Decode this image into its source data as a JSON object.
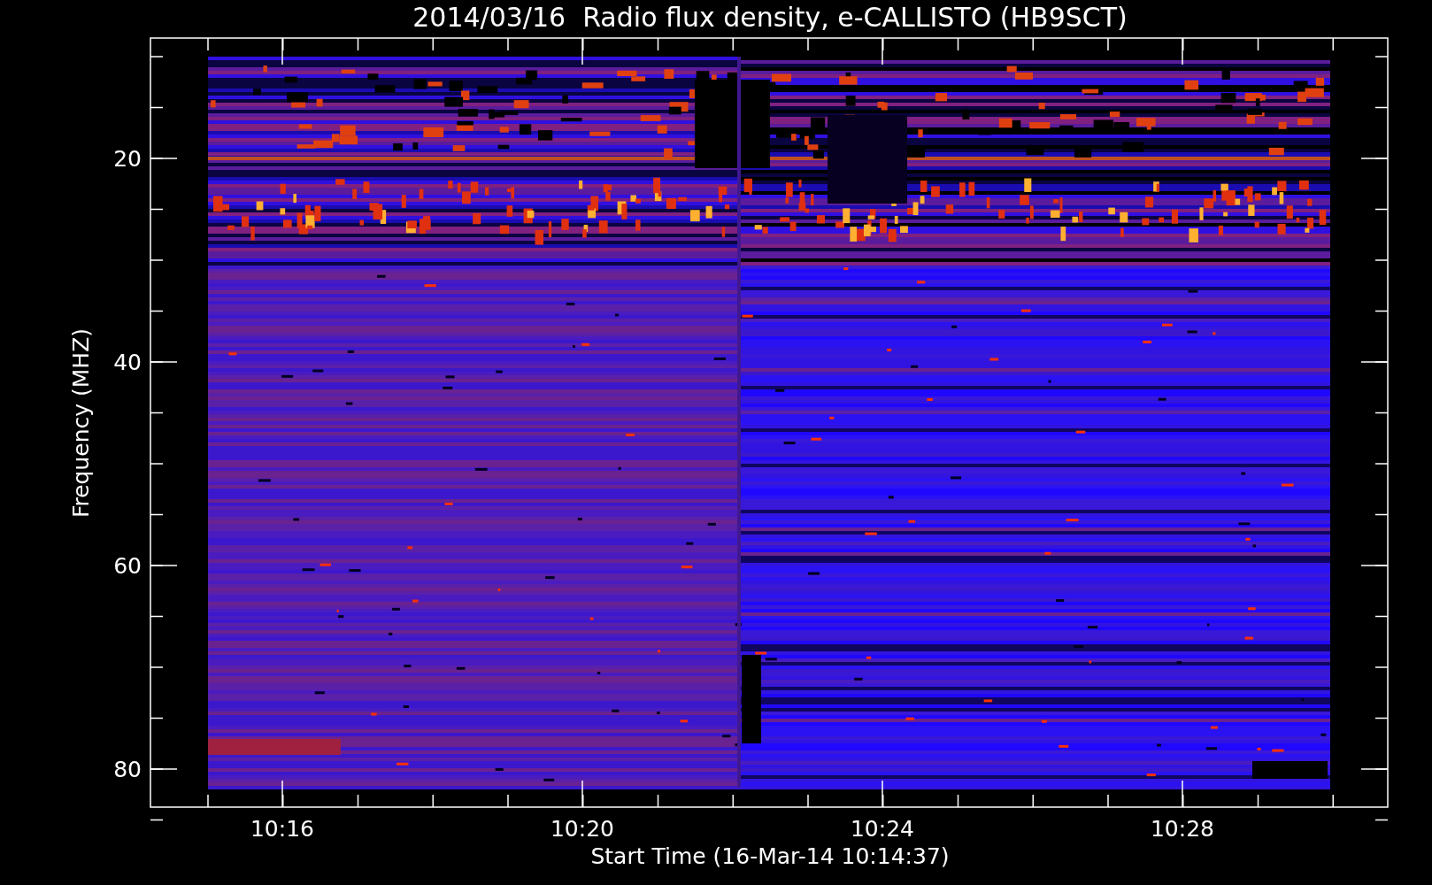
{
  "chart": {
    "title": "2014/03/16  Radio flux density, e-CALLISTO (HB9SCT)",
    "y_axis": {
      "label": "Frequency (MHZ)",
      "ticks": [
        "20",
        "40",
        "60",
        "80"
      ]
    },
    "x_axis": {
      "label": "Start Time (16-Mar-14 10:14:37)",
      "ticks": [
        "10:16",
        "10:20",
        "10:24",
        "10:28"
      ]
    }
  }
}
